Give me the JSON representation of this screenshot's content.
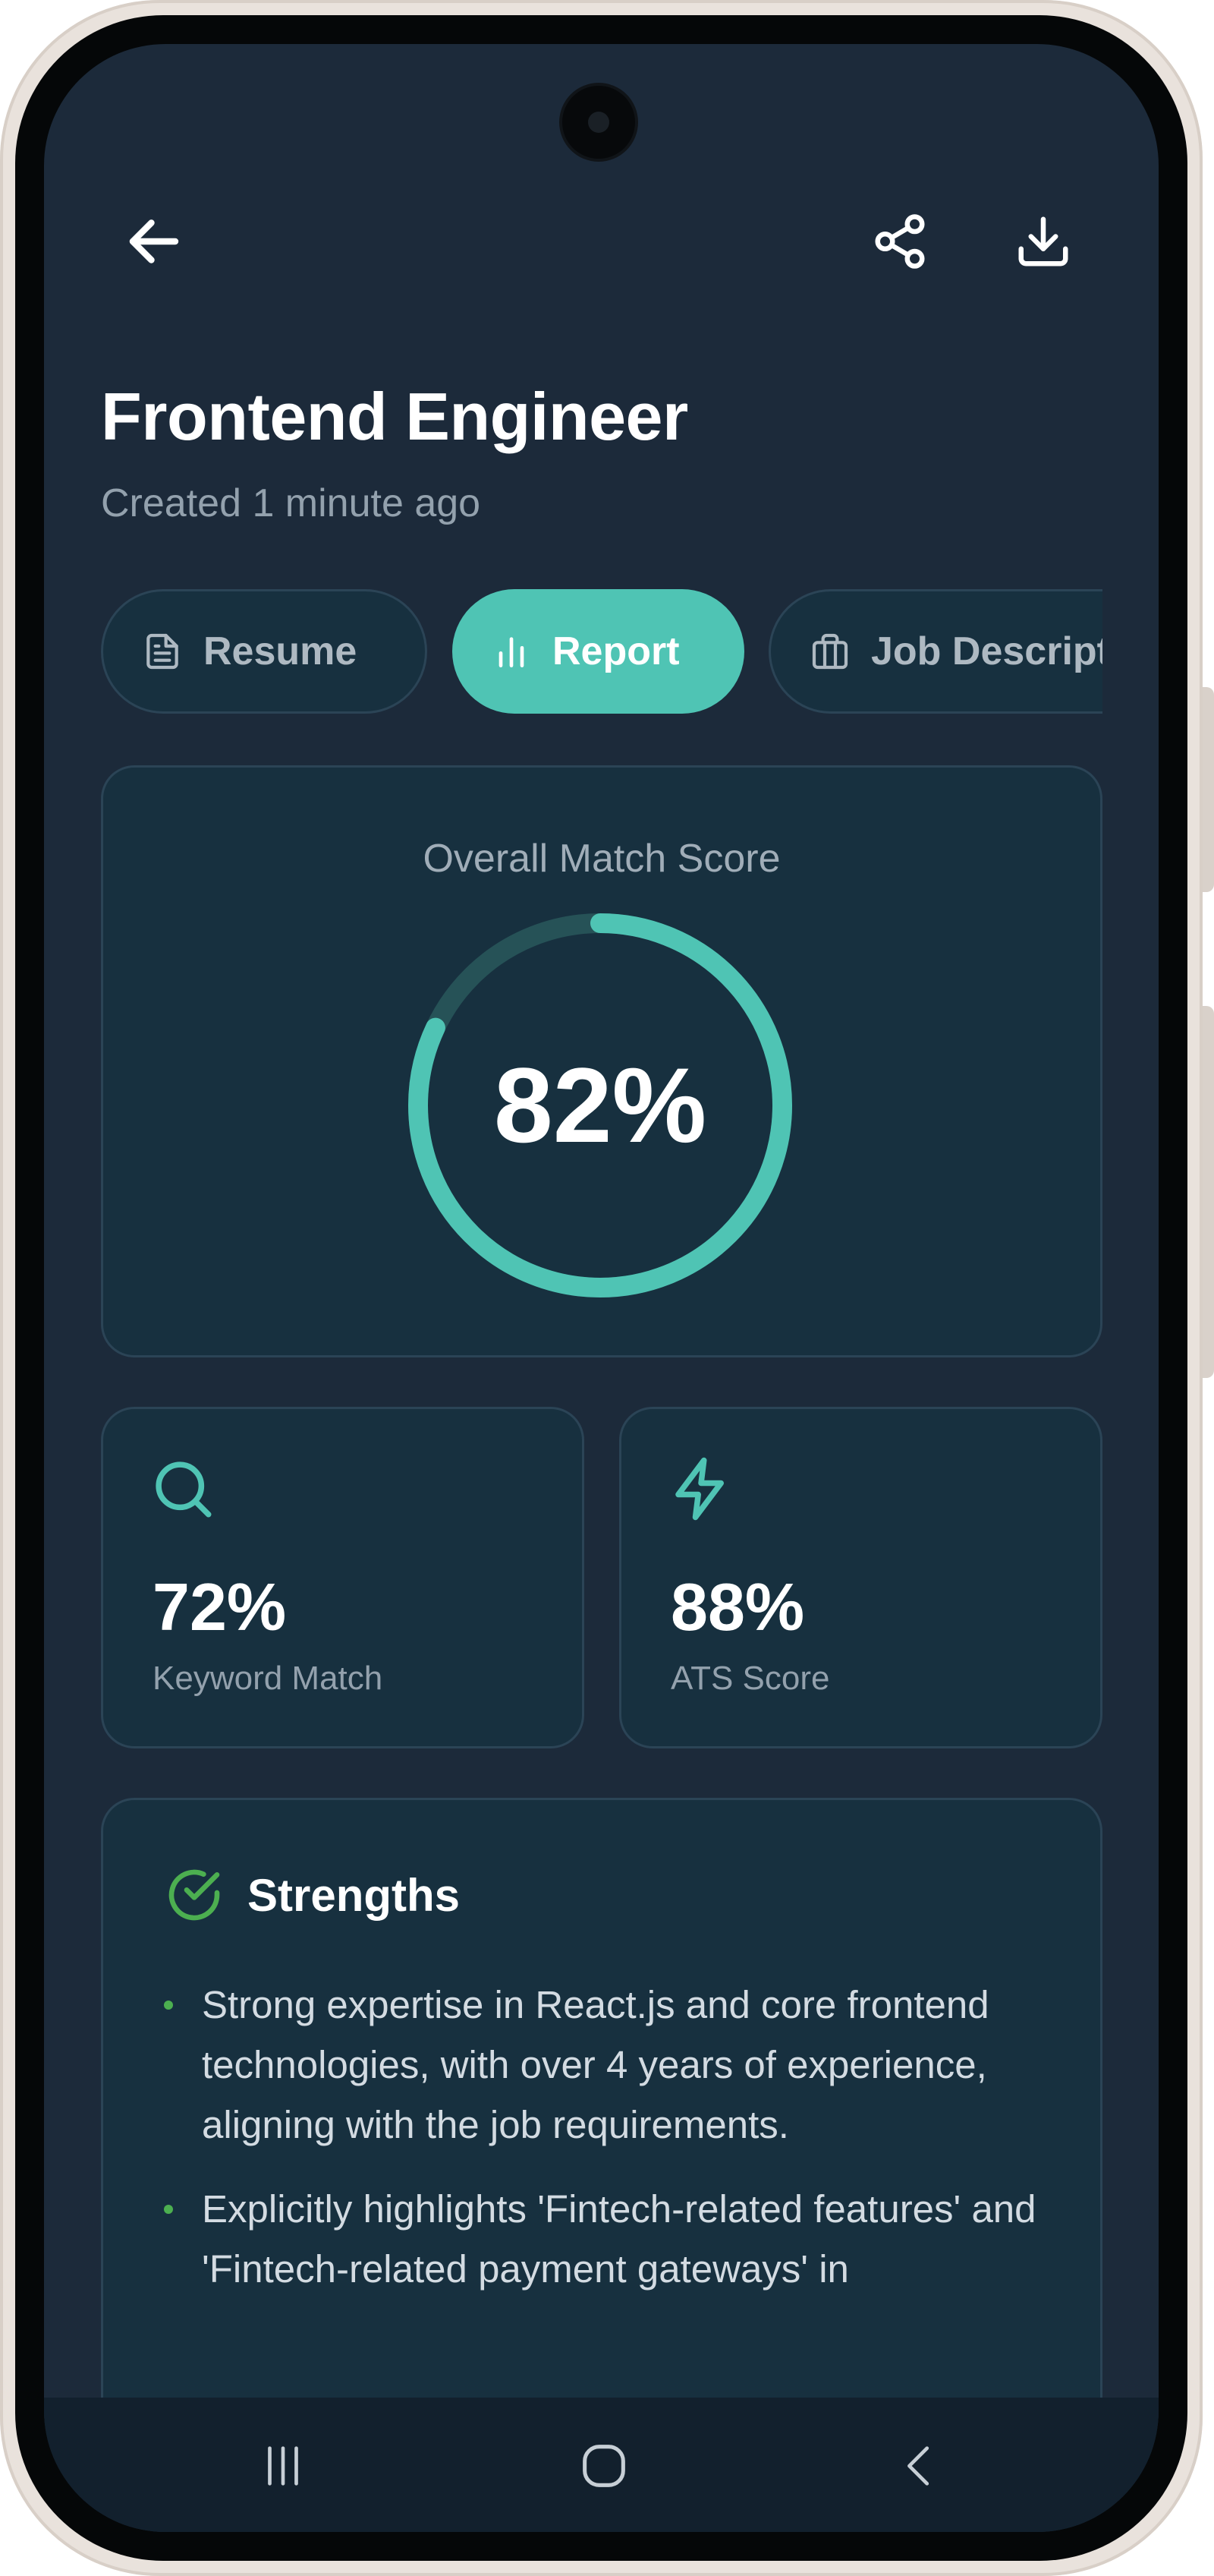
{
  "header": {
    "title": "Frontend Engineer",
    "subtitle": "Created 1 minute ago"
  },
  "tabs": [
    {
      "label": "Resume",
      "icon": "document-icon",
      "active": false
    },
    {
      "label": "Report",
      "icon": "bar-chart-icon",
      "active": true
    },
    {
      "label": "Job Description",
      "icon": "briefcase-icon",
      "active": false
    }
  ],
  "overall": {
    "label": "Overall Match Score",
    "value": "82%",
    "fraction": 0.82
  },
  "metrics": [
    {
      "value": "72%",
      "label": "Keyword Match",
      "icon": "search-icon"
    },
    {
      "value": "88%",
      "label": "ATS Score",
      "icon": "lightning-icon"
    }
  ],
  "strengths": {
    "title": "Strengths",
    "items": [
      "Strong expertise in React.js and core frontend technologies, with over 4 years of experience, aligning with the job requirements.",
      "Explicitly highlights 'Fintech-related features' and 'Fintech-related payment gateways' in"
    ]
  },
  "colors": {
    "accent": "#4fc4b4",
    "background": "#1c2a3a",
    "card": "#17303f",
    "success": "#4caf50"
  }
}
